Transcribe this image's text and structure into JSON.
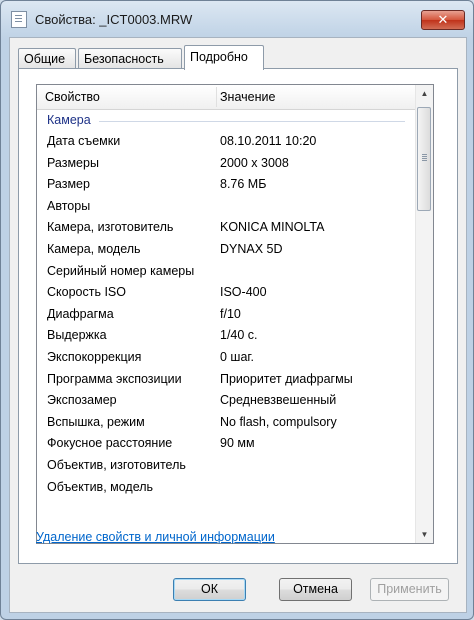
{
  "window": {
    "title": "Свойства: _ICT0003.MRW",
    "close_glyph": "✕",
    "icon": "file-properties-icon"
  },
  "tabs": [
    {
      "label": "Общие"
    },
    {
      "label": "Безопасность"
    },
    {
      "label": "Подробно",
      "active": true
    }
  ],
  "list": {
    "columns": {
      "property": "Свойство",
      "value": "Значение"
    },
    "group": "Камера",
    "rows": [
      {
        "name": "Дата съемки",
        "value": "08.10.2011 10:20"
      },
      {
        "name": "Размеры",
        "value": "2000 x 3008"
      },
      {
        "name": "Размер",
        "value": "8.76 МБ"
      },
      {
        "name": "Авторы",
        "value": ""
      },
      {
        "name": "Камера, изготовитель",
        "value": "KONICA MINOLTA"
      },
      {
        "name": "Камера, модель",
        "value": "DYNAX 5D"
      },
      {
        "name": "Серийный номер камеры",
        "value": ""
      },
      {
        "name": "Скорость ISO",
        "value": "ISO-400"
      },
      {
        "name": "Диафрагма",
        "value": "f/10"
      },
      {
        "name": "Выдержка",
        "value": "1/40 с."
      },
      {
        "name": "Экспокоррекция",
        "value": "0 шаг."
      },
      {
        "name": "Программа экспозиции",
        "value": "Приоритет диафрагмы"
      },
      {
        "name": "Экспозамер",
        "value": "Средневзвешенный"
      },
      {
        "name": "Вспышка, режим",
        "value": "No flash, compulsory"
      },
      {
        "name": "Фокусное расстояние",
        "value": "90 мм"
      },
      {
        "name": "Объектив, изготовитель",
        "value": ""
      },
      {
        "name": "Объектив, модель",
        "value": ""
      }
    ]
  },
  "scrollbar": {
    "up_glyph": "▲",
    "down_glyph": "▼"
  },
  "remove_link": "Удаление свойств и личной информации",
  "buttons": {
    "ok": "ОК",
    "cancel": "Отмена",
    "apply": "Применить"
  }
}
